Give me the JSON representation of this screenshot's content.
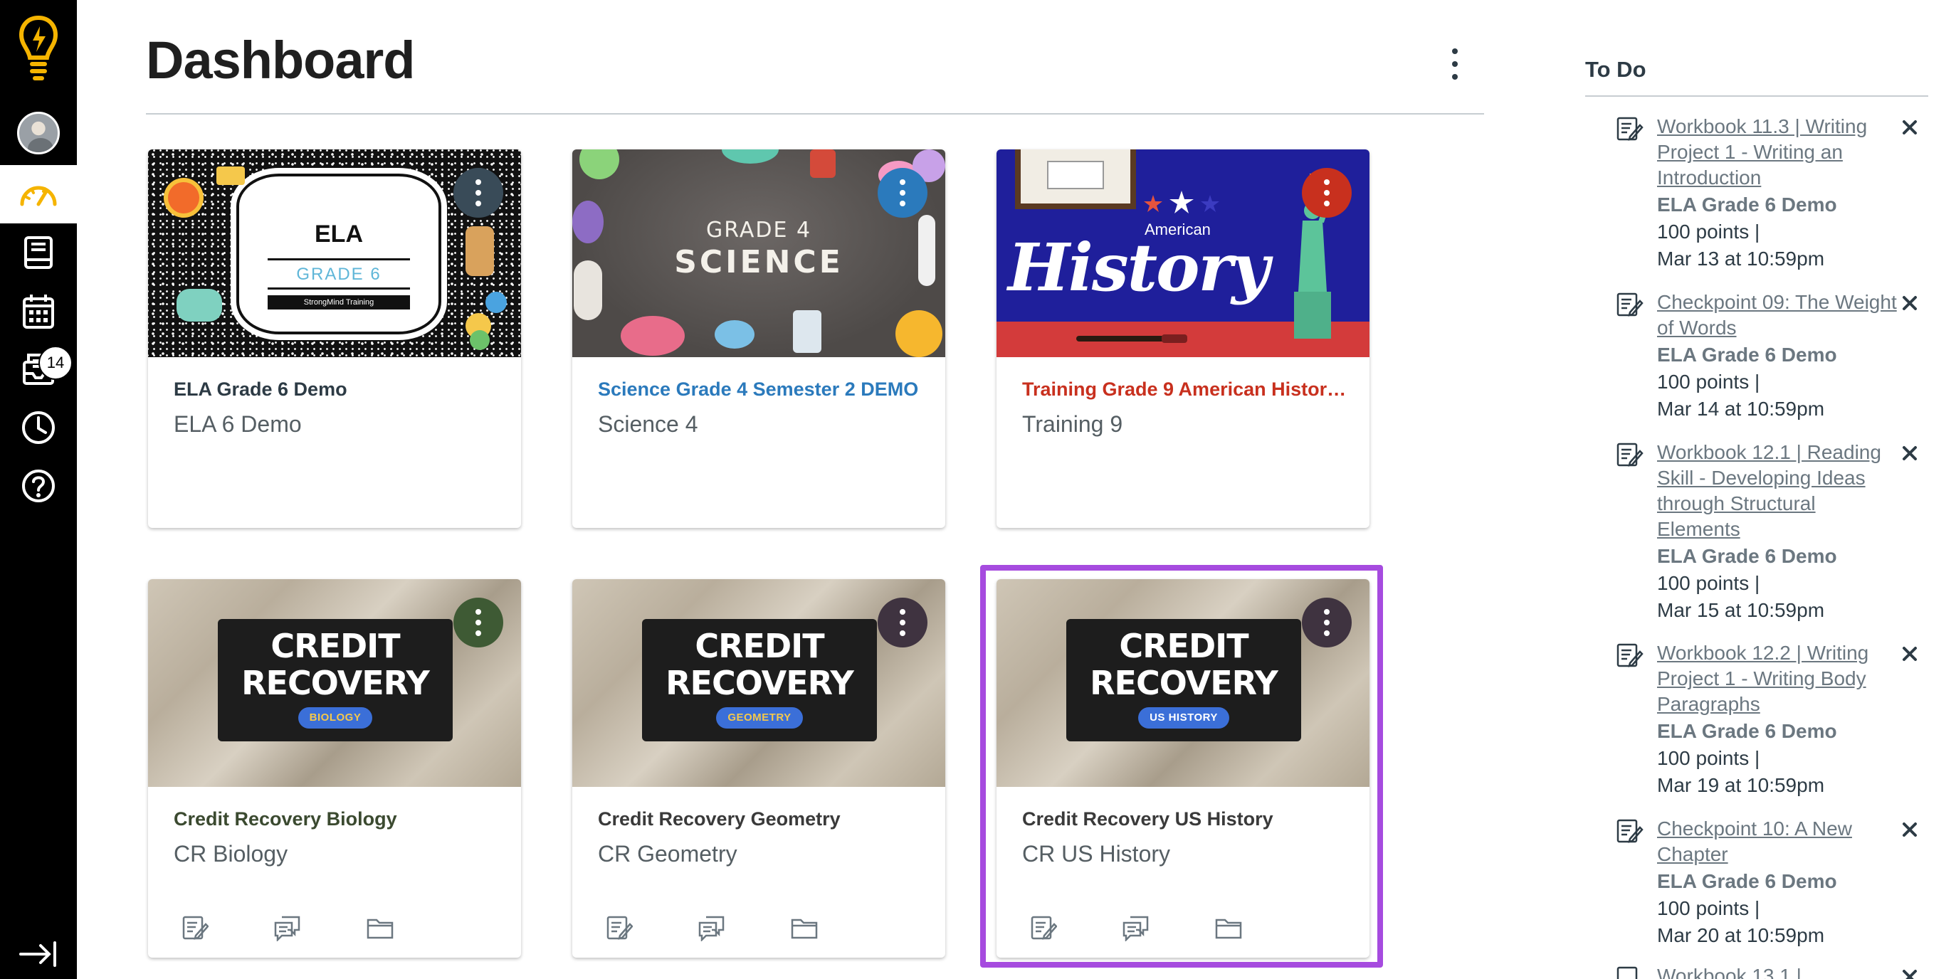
{
  "nav": {
    "inbox_badge": "14",
    "colors": {
      "background": "#000000",
      "logo": "#f5b400",
      "active": "#f5b400"
    },
    "icons": [
      "logo-lightbulb-icon",
      "account-avatar",
      "dashboard-icon",
      "courses-icon",
      "calendar-icon",
      "inbox-icon",
      "history-icon",
      "help-icon",
      "collapse-nav-icon"
    ]
  },
  "header": {
    "title": "Dashboard"
  },
  "cards": [
    {
      "title": "ELA Grade 6 Demo",
      "subtitle": "ELA 6 Demo",
      "color": "#2d3b45",
      "menu_color": "#394b58",
      "hero": {
        "heading": "ELA",
        "grade": "GRADE 6",
        "brand": "StrongMind Training"
      }
    },
    {
      "title": "Science Grade 4 Semester 2 DEMO",
      "subtitle": "Science 4",
      "color": "#2b7abc",
      "menu_color": "#2b7abc",
      "hero": {
        "line1": "GRADE 4",
        "line2": "SCIENCE"
      }
    },
    {
      "title": "Training Grade 9 American History...",
      "subtitle": "Training 9",
      "color": "#c8301e",
      "menu_color": "#c8301e",
      "hero": {
        "small": "American",
        "word": "History"
      }
    },
    {
      "title": "Credit Recovery Biology",
      "subtitle": "CR Biology",
      "color": "#3b4a30",
      "menu_color": "#3e5a34",
      "hero": {
        "line1": "CREDIT",
        "line2": "RECOVERY",
        "pill": "BIOLOGY",
        "pill_color": "#3b6fd8",
        "pill_text_color": "#f5c84b"
      }
    },
    {
      "title": "Credit Recovery Geometry",
      "subtitle": "CR Geometry",
      "color": "#3a3a3a",
      "menu_color": "#3f3340",
      "hero": {
        "line1": "CREDIT",
        "line2": "RECOVERY",
        "pill": "GEOMETRY",
        "pill_color": "#3b6fd8",
        "pill_text_color": "#f5c84b"
      }
    },
    {
      "title": "Credit Recovery US History",
      "subtitle": "CR US History",
      "color": "#3a3a3a",
      "menu_color": "#3f3340",
      "hero": {
        "line1": "CREDIT",
        "line2": "RECOVERY",
        "pill": "US HISTORY",
        "pill_color": "#3b6fd8",
        "pill_text_color": "#ffffff"
      }
    }
  ],
  "highlight_color": "#a64bdf",
  "todo": {
    "title": "To Do",
    "items": [
      {
        "title": "Workbook 11.3 | Writing Project 1 - Writing an Introduction",
        "course": "ELA Grade 6 Demo",
        "points": "100 points  |",
        "due": "Mar 13 at 10:59pm"
      },
      {
        "title": "Checkpoint 09: The Weight of Words",
        "course": "ELA Grade 6 Demo",
        "points": "100 points  |",
        "due": "Mar 14 at 10:59pm"
      },
      {
        "title": "Workbook 12.1 | Reading Skill - Developing Ideas through Structural Elements",
        "course": "ELA Grade 6 Demo",
        "points": "100 points  |",
        "due": "Mar 15 at 10:59pm"
      },
      {
        "title": "Workbook 12.2 | Writing Project 1 - Writing Body Paragraphs",
        "course": "ELA Grade 6 Demo",
        "points": "100 points  |",
        "due": "Mar 19 at 10:59pm"
      },
      {
        "title": "Checkpoint 10: A New Chapter",
        "course": "ELA Grade 6 Demo",
        "points": "100 points  |",
        "due": "Mar 20 at 10:59pm"
      },
      {
        "title": "Workbook 13.1 |",
        "course": "",
        "points": "",
        "due": ""
      }
    ]
  }
}
